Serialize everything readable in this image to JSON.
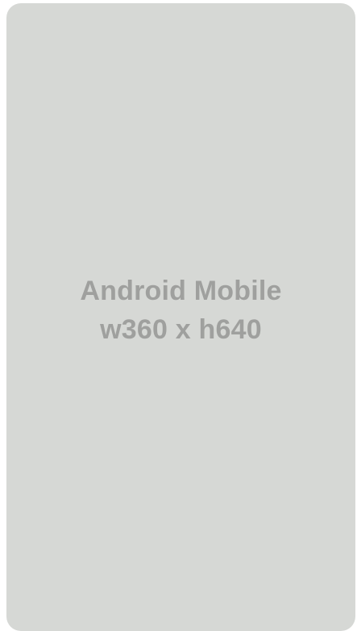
{
  "placeholder": {
    "title_line": "Android Mobile",
    "size_line": "w360 x h640"
  },
  "colors": {
    "card_background": "#d6d8d5",
    "text": "#9fa09e",
    "page_background": "#ffffff"
  }
}
